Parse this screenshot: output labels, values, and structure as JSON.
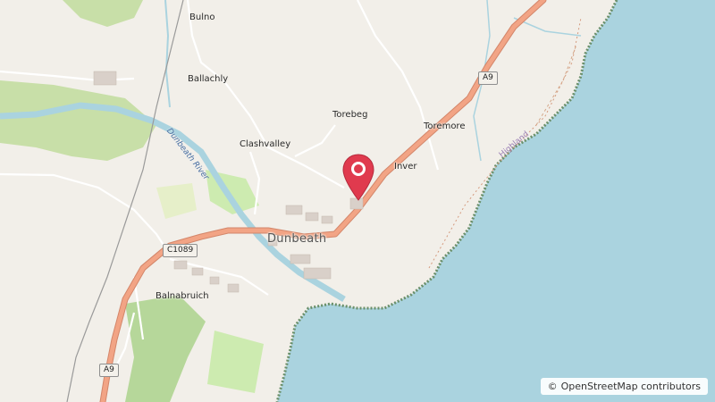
{
  "places": {
    "bulno": "Bulno",
    "ballachly": "Ballachly",
    "torebeg": "Torebeg",
    "toremore": "Toremore",
    "clashvalley": "Clashvalley",
    "inver": "Inver",
    "dunbeath": "Dunbeath",
    "balnabruich": "Balnabruich"
  },
  "roads": {
    "a9_north": "A9",
    "a9_south": "A9",
    "c1089": "C1089"
  },
  "water": {
    "river": "Dunbeath River"
  },
  "region": {
    "boundary_label": "Highland"
  },
  "attribution": {
    "symbol": "©",
    "text": "OpenStreetMap contributors"
  },
  "colors": {
    "land": "#f2efe9",
    "sea": "#aad3df",
    "road_primary": "#f2a485",
    "field_green": "#c8dfa8",
    "marker": "#e03a4e"
  },
  "icons": {
    "marker": "location-pin-icon"
  }
}
